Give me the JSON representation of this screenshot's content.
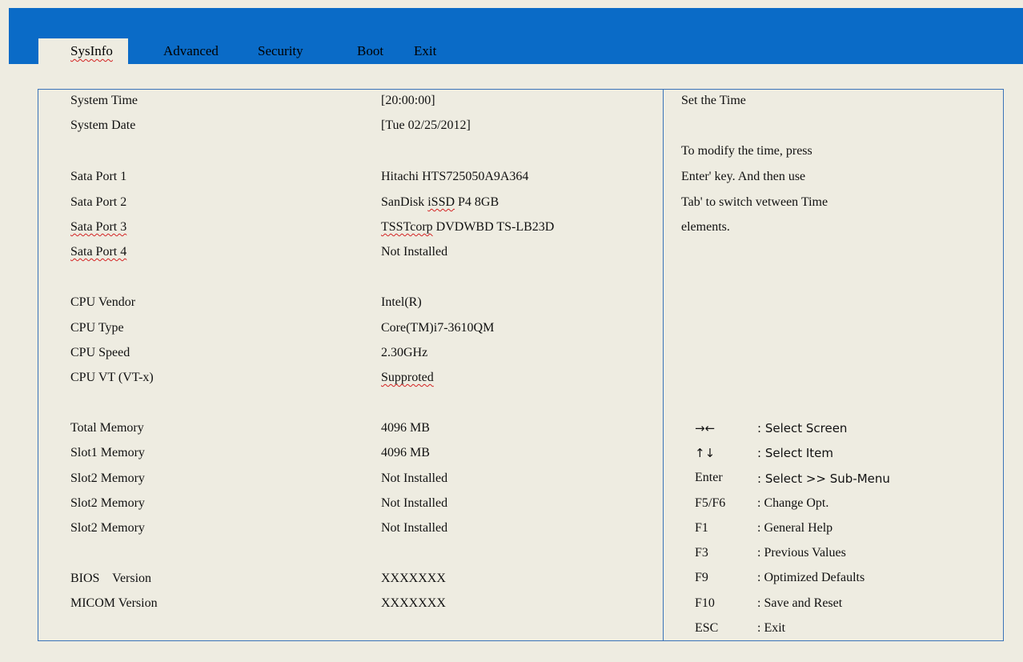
{
  "tabs": [
    {
      "label": "SysInfo",
      "active": true
    },
    {
      "label": "Advanced"
    },
    {
      "label": "Security"
    },
    {
      "label": "Boot"
    },
    {
      "label": "Exit"
    }
  ],
  "items": [
    {
      "label": "System Time",
      "value": "[20:00:00]"
    },
    {
      "label": "System Date",
      "value": "[Tue 02/25/2012]"
    },
    {
      "label": "Sata Port 1",
      "value": "Hitachi HTS725050A9A364"
    },
    {
      "label": "Sata Port 2",
      "value_pre": "SanDisk ",
      "value_mark": "iSSD",
      "value_post": " P4 8GB"
    },
    {
      "label": "Sata Port 3",
      "value_mark": "TSSTcorp",
      "value_post": " DVDWBD TS-LB23D"
    },
    {
      "label": "Sata Port 4",
      "value": "Not Installed"
    },
    {
      "label": "CPU Vendor",
      "value": "Intel(R)"
    },
    {
      "label": "CPU Type",
      "value": "Core(TM)i7-3610QM"
    },
    {
      "label": "CPU Speed",
      "value": "2.30GHz"
    },
    {
      "label": "CPU VT (VT-x)",
      "value": "Supproted"
    },
    {
      "label": "Total Memory",
      "value": "4096 MB"
    },
    {
      "label": "Slot1 Memory",
      "value": "4096 MB"
    },
    {
      "label": "Slot2 Memory",
      "value": "Not Installed"
    },
    {
      "label": "Slot2 Memory",
      "value": "Not Installed"
    },
    {
      "label": "Slot2 Memory",
      "value": "Not Installed"
    },
    {
      "label": "BIOS    Version",
      "value": "XXXXXXX"
    },
    {
      "label": "MICOM Version",
      "value": "XXXXXXX"
    }
  ],
  "help": {
    "title": "Set the Time",
    "lines": [
      "To modify the time, press",
      "Enter' key. And then use",
      "Tab' to switch vetween Time",
      "elements."
    ]
  },
  "keys": [
    {
      "key": "→←",
      "desc": ": Select Screen"
    },
    {
      "key": "↑↓",
      "desc": ": Select Item"
    },
    {
      "key": "Enter",
      "desc": ": Select >> Sub-Menu"
    },
    {
      "key": "F5/F6",
      "desc": ": Change Opt."
    },
    {
      "key": "F1",
      "desc": ": General Help"
    },
    {
      "key": "F3",
      "desc": ": Previous Values"
    },
    {
      "key": "F9",
      "desc": ": Optimized Defaults"
    },
    {
      "key": "F10",
      "desc": ": Save and Reset"
    },
    {
      "key": "ESC",
      "desc": ": Exit"
    }
  ],
  "colors": {
    "header_bar": "#0A6BC7",
    "background": "#EEECE1",
    "panel_border": "#3A73B8"
  }
}
